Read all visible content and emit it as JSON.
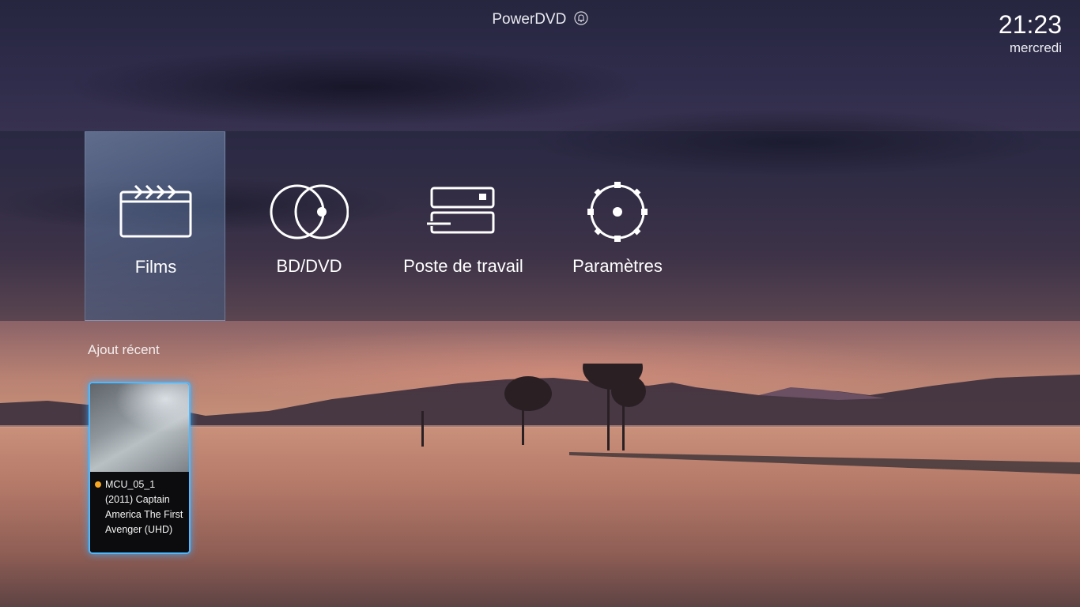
{
  "app": {
    "title": "PowerDVD",
    "notification_icon": "bell-icon"
  },
  "clock": {
    "time": "21:23",
    "day": "mercredi"
  },
  "menu": {
    "items": [
      {
        "label": "Films",
        "icon": "clapperboard-icon",
        "selected": true
      },
      {
        "label": "BD/DVD",
        "icon": "disc-icon",
        "selected": false
      },
      {
        "label": "Poste de travail",
        "icon": "computer-drive-icon",
        "selected": false
      },
      {
        "label": "Paramètres",
        "icon": "gear-icon",
        "selected": false
      }
    ]
  },
  "recent": {
    "title": "Ajout récent",
    "items": [
      {
        "title": "MCU_05_1 (2011) Captain America The First Avenger (UHD)",
        "status_color": "#f5a623"
      }
    ]
  },
  "colors": {
    "selection_glow": "#4fb8ff",
    "status_dot": "#f5a623"
  }
}
